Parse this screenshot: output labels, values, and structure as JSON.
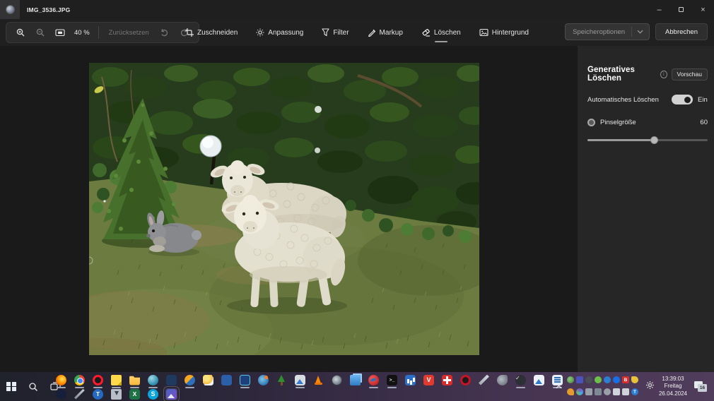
{
  "window": {
    "title": "IMG_3536.JPG",
    "controls": {
      "minimize": "–",
      "close": "×"
    }
  },
  "toolbar": {
    "zoom_value": "40 %",
    "reset_label": "Zurücksetzen"
  },
  "tabs": [
    {
      "label": "Zuschneiden"
    },
    {
      "label": "Anpassung"
    },
    {
      "label": "Filter"
    },
    {
      "label": "Markup"
    },
    {
      "label": "Löschen",
      "active": true
    },
    {
      "label": "Hintergrund"
    }
  ],
  "actions": {
    "save_options_label": "Speicheroptionen",
    "cancel_label": "Abbrechen"
  },
  "panel": {
    "title": "Generatives Löschen",
    "info_glyph": "i",
    "preview_badge": "Vorschau",
    "auto_erase_label": "Automatisches Löschen",
    "auto_erase_state": "Ein",
    "brush_label": "Pinselgröße",
    "brush_value": "60",
    "brush_slider_percent": 55
  },
  "photo": {
    "description": "Garden photo: two white sheep figurines and a grey rabbit figurine on a lawn beside a small conifer and a white globe solar lamp, dark leafy hedge behind"
  },
  "taskbar": {
    "clock": {
      "time": "13:39:03",
      "weekday": "Freitag",
      "date": "26.04.2024"
    },
    "notification_badge": "16",
    "glyphs": {
      "cmd": ">_",
      "brave_v": "V",
      "check": "✓",
      "excel": "X",
      "skype": "S",
      "teamviewer": "T",
      "red_b": "B",
      "tray_t": "T"
    },
    "pinned_row1": [
      "Firefox",
      "Chrome",
      "Opera",
      "Sticky Notes",
      "File Explorer",
      "Browser Sphere",
      "Calculator",
      "Orange-Blue App",
      "Weather",
      "Blue Cloud App",
      "Blue Tech App",
      "Paint 3D",
      "Tree Tool",
      "Image Viewer",
      "VLC",
      "Camera Tool",
      "Folder Pair",
      "CCleaner",
      "Command Prompt",
      "Blue Chart App",
      "Brave",
      "Red Cross App",
      "Opera GX",
      "Pen Tool",
      "Grey Tool",
      "Check App",
      "Photo Viewer",
      "Document App"
    ],
    "pinned_row2": [
      "Unity",
      "Pen",
      "TeamViewer",
      "Installer",
      "Excel",
      "Skype",
      "Photos (active)"
    ],
    "tray_row1": [
      "Globe App",
      "Teams",
      "Dark App",
      "Green App",
      "Blue App",
      "Bluetooth",
      "Red B App",
      "Yellow App"
    ],
    "tray_row2": [
      "Search Key",
      "Palette",
      "USB Device",
      "Display",
      "Settings",
      "Volume",
      "Battery",
      "Blue T App"
    ]
  }
}
